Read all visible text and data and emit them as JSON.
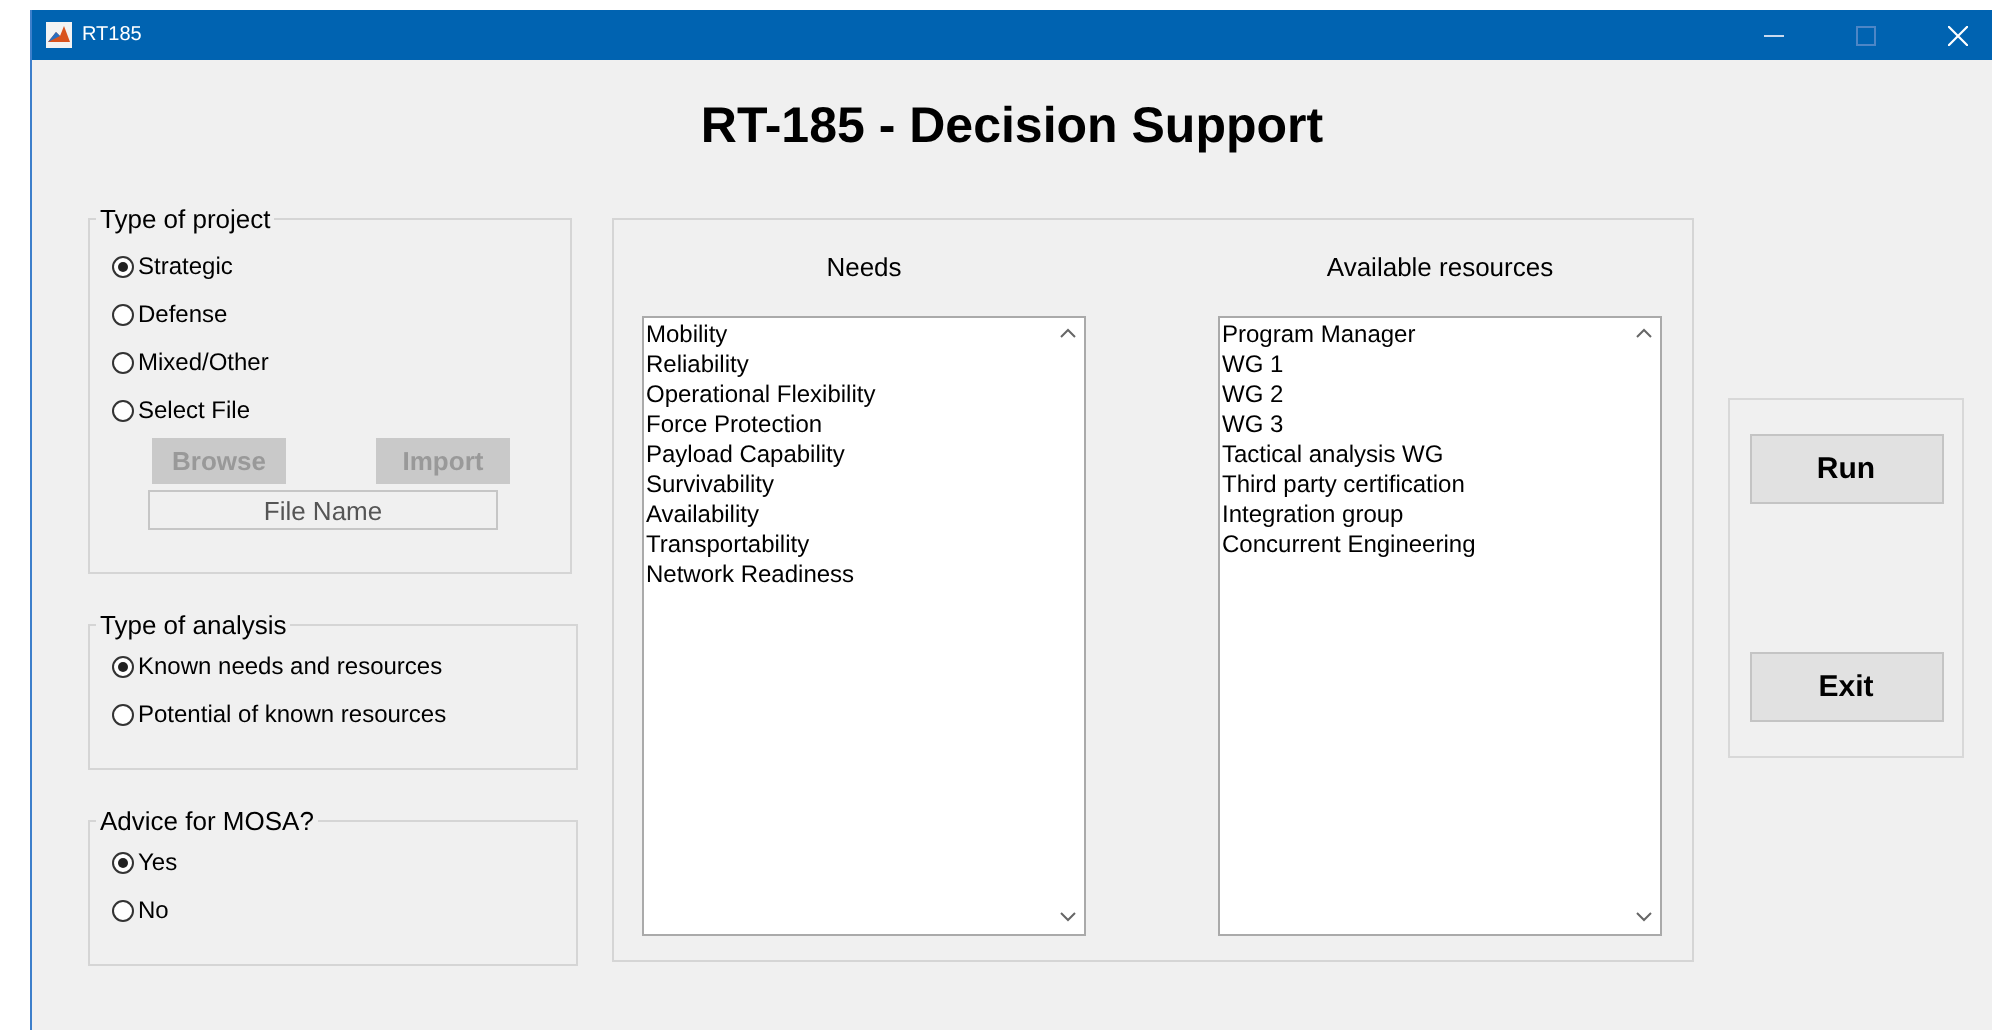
{
  "window": {
    "title": "RT185"
  },
  "heading": "RT-185 - Decision Support",
  "project_type": {
    "title": "Type of project",
    "options": [
      {
        "label": "Strategic",
        "selected": true
      },
      {
        "label": "Defense",
        "selected": false
      },
      {
        "label": "Mixed/Other",
        "selected": false
      },
      {
        "label": "Select File",
        "selected": false
      }
    ],
    "buttons": [
      {
        "label": "Browse",
        "disabled": true
      },
      {
        "label": "Import",
        "disabled": true
      }
    ],
    "file_field": {
      "value": "File Name",
      "disabled": true
    }
  },
  "analysis_type": {
    "title": "Type of analysis",
    "options": [
      {
        "label": "Known needs and resources",
        "selected": true
      },
      {
        "label": "Potential of known resources",
        "selected": false
      }
    ]
  },
  "mosa": {
    "title": "Advice for MOSA?",
    "options": [
      {
        "label": "Yes",
        "selected": true
      },
      {
        "label": "No",
        "selected": false
      }
    ]
  },
  "lists": [
    {
      "title": "Needs",
      "items": [
        "Mobility",
        "Reliability",
        "Operational Flexibility",
        "Force Protection",
        "Payload Capability",
        "Survivability",
        "Availability",
        "Transportability",
        "Network Readiness"
      ]
    },
    {
      "title": "Available resources",
      "items": [
        "Program Manager",
        "WG 1",
        "WG 2",
        "WG 3",
        "Tactical analysis WG",
        "Third party certification",
        "Integration group",
        "Concurrent Engineering"
      ]
    }
  ],
  "actions": [
    {
      "label": "Run"
    },
    {
      "label": "Exit"
    }
  ]
}
